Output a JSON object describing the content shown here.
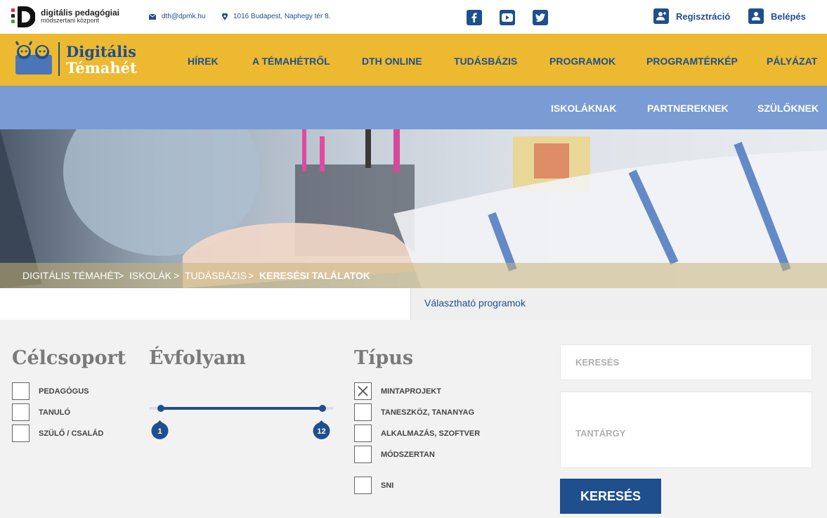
{
  "topbar": {
    "logo_line1": "digitális pedagógiai",
    "logo_line2": "módszertani központ",
    "email": "dth@dpmk.hu",
    "address": "1016 Budapest, Naphegy tér 8.",
    "social": [
      "facebook-icon",
      "youtube-icon",
      "twitter-icon"
    ],
    "register": "Regisztráció",
    "login": "Belépés"
  },
  "brand": {
    "line1": "Digitális",
    "line2": "Témahét"
  },
  "mainnav": [
    "HÍREK",
    "A TÉMAHÉTRŐL",
    "DTH ONLINE",
    "TUDÁSBÁZIS",
    "PROGRAMOK",
    "PROGRAMTÉRKÉP",
    "PÁLYÁZAT"
  ],
  "subnav": [
    "ISKOLÁKNAK",
    "PARTNEREKNEK",
    "SZÜLŐKNEK"
  ],
  "breadcrumb": {
    "items": [
      "DIGITÁLIS TÉMAHÉT",
      "ISKOLÁK",
      "TUDÁSBÁZIS",
      "KERESÉSI TALÁLATOK"
    ],
    "sep": ">"
  },
  "tabs": {
    "second": "Választható programok"
  },
  "filters": {
    "target": {
      "title": "Célcsoport",
      "options": [
        {
          "label": "PEDAGÓGUS",
          "checked": false
        },
        {
          "label": "TANULÓ",
          "checked": false
        },
        {
          "label": "SZÜLŐ / CSALÁD",
          "checked": false
        }
      ]
    },
    "grade": {
      "title": "Évfolyam",
      "min": "1",
      "max": "12"
    },
    "type": {
      "title": "Típus",
      "options": [
        {
          "label": "MINTAPROJEKT",
          "checked": true
        },
        {
          "label": "TANESZKÖZ, TANANYAG",
          "checked": false
        },
        {
          "label": "ALKALMAZÁS, SZOFTVER",
          "checked": false
        },
        {
          "label": "MÓDSZERTAN",
          "checked": false
        },
        {
          "label": "SNI",
          "checked": false
        }
      ]
    }
  },
  "search": {
    "placeholder": "KERESÉS",
    "subject_placeholder": "TANTÁRGY",
    "button": "KERESÉS"
  },
  "colors": {
    "brand_blue": "#1f4f8c",
    "yellow": "#ecb930",
    "light_blue": "#7a9bd4"
  }
}
